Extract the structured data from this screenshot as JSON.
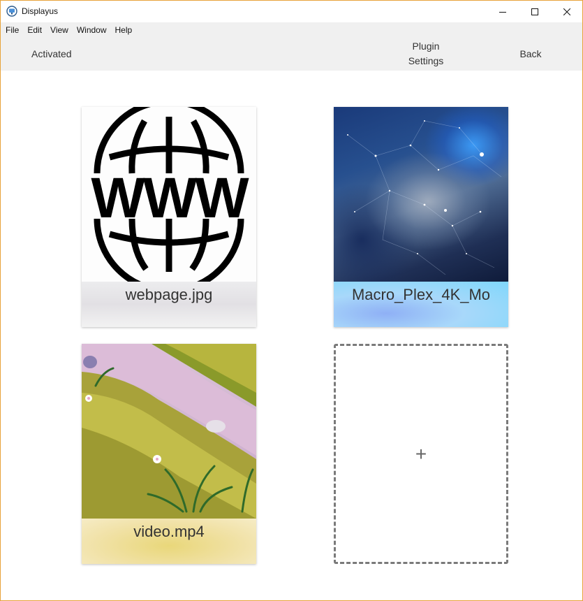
{
  "window": {
    "title": "Displayus"
  },
  "menu": {
    "items": [
      "File",
      "Edit",
      "View",
      "Window",
      "Help"
    ]
  },
  "toolbar": {
    "activated_label": "Activated",
    "plugin_settings_line1": "Plugin",
    "plugin_settings_line2": "Settings",
    "back_label": "Back"
  },
  "cards": [
    {
      "label": "webpage.jpg",
      "thumbnail": "globe-www-icon"
    },
    {
      "label": "Macro_Plex_4K_Mo",
      "thumbnail": "space-nebula-image"
    },
    {
      "label": "video.mp4",
      "thumbnail": "grass-stream-image"
    }
  ],
  "add_card": {
    "symbol": "+"
  }
}
